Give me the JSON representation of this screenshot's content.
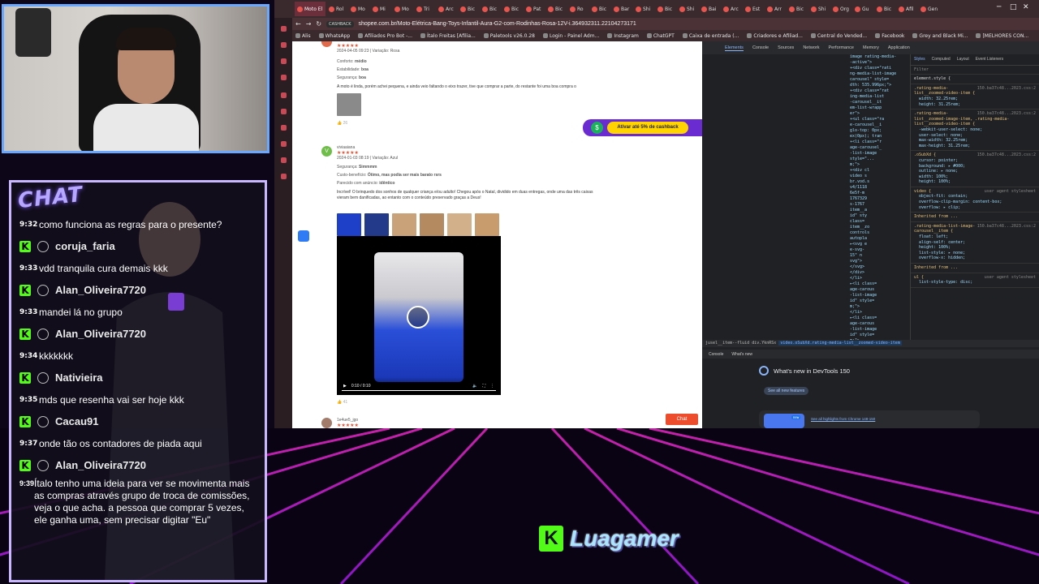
{
  "browser": {
    "active_tab": "Moto El",
    "tabs": [
      "Rol",
      "Mo",
      "Mi",
      "Mo",
      "Tri",
      "Arc",
      "Bic",
      "Bic",
      "Bic",
      "Pat",
      "Bic",
      "Ro",
      "Bic",
      "Bar",
      "Shi",
      "Bic",
      "Shi",
      "Bai",
      "Arc",
      "Est",
      "Arr",
      "Bic",
      "Shi",
      "Org",
      "Gu",
      "Bic",
      "Afil",
      "Gen"
    ],
    "url": "shopee.com.br/Moto-Elétrica-Bang-Toys-Infantil-Aura-G2-com-Rodinhas-Rosa-12V-i.364932311.22104273171",
    "cashback_chip": "CASHBACK",
    "bookmarks": [
      "Alis",
      "WhatsApp",
      "Afiliados Pro Bot -...",
      "Ítalo Freitas [Afilia...",
      "Paletools v26.0.28",
      "Login - Painel Adm...",
      "Instagram",
      "ChatGPT",
      "Caixa de entrada (...",
      "Criadores e Afiliad...",
      "Central do Vended...",
      "Facebook",
      "Grey and Black Mi...",
      "[MELHORES CON..."
    ]
  },
  "review1": {
    "meta": "2024-04-05 09:23 | Variação: Rosa",
    "conforto_label": "Conforto:",
    "conforto": "médio",
    "estabilidade_label": "Estabilidade:",
    "estabilidade": "boa",
    "seguranca_label": "Segurança:",
    "seguranca": "boa",
    "text": "A moto é linda, porém achei pequena, e ainda veio faltando o eixo trazer, tive que comprar a parte, do restante foi uma boa compra o",
    "likes": "26"
  },
  "review2": {
    "avatar": "V",
    "user": "viviaaiana",
    "meta": "2024-01-03 08:19 | Variação: Azul",
    "seguranca_label": "Segurança:",
    "seguranca": "Simmmm",
    "custo_label": "Custo-benefício:",
    "custo": "Ótimo, mas podia ser mais barato rsrs",
    "parecido_label": "Parecido com anúncio:",
    "parecido": "idêntico",
    "text": "Incrível! O brinquedo dos sonhos de qualquer criança e/ou adulto! Chegou após o Natal, dividido em duas entregas, onde uma das três caixas vieram bem danificadas, ao entanto com o conteúdo preservado graças a Deus!",
    "video_time": "0:10 / 0:10",
    "likes": "41"
  },
  "review3": {
    "user": "1e4ue5_jgo"
  },
  "stars": "★★★★★",
  "cashback_banner": {
    "coin": "$",
    "label": "Ativar até 5% de cashback"
  },
  "chat_button": "Chat",
  "devtools": {
    "tabs": [
      "Elements",
      "Console",
      "Sources",
      "Network",
      "Performance",
      "Memory",
      "Application"
    ],
    "active_tab": "Elements",
    "styles_tabs": [
      "Styles",
      "Computed",
      "Layout",
      "Event Listeners"
    ],
    "filter_placeholder": "Filter",
    "element_style": "element.style {",
    "rules": [
      {
        "selector": ".rating-media-list__zoomed-video-item {",
        "source": "150.ba37c48...2023.css:2",
        "props": [
          "width: 32.25rem;",
          "height: 31.25rem;"
        ]
      },
      {
        "selector": ".rating-media-list__zoomed-image-item, .rating-media-list__zoomed-video-item {",
        "source": "150.ba37c48...2023.css:2",
        "props": [
          "-webkit-user-select: none;",
          "user-select: none;",
          "max-width: 32.25rem;",
          "max-height: 31.25rem;"
        ]
      },
      {
        "selector": ".oSubXd {",
        "source": "150.ba37c48...2023.css:2",
        "props": [
          "cursor: pointer;",
          "background: ▸ #000;",
          "outline: ▸ none;",
          "width: 100%;",
          "height: 100%;"
        ]
      },
      {
        "selector": "video {",
        "source": "user agent stylesheet",
        "props": [
          "object-fit: contain;",
          "overflow-clip-margin: content-box;",
          "overflow: ▸ clip;"
        ]
      },
      {
        "selector": "Inherited from ...",
        "source": "",
        "props": []
      },
      {
        "selector": ".rating-media-list-image-carousel__item {",
        "source": "150.ba37c48...2023.css:2",
        "props": [
          "float: left;",
          "align-self: center;",
          "height: 100%;",
          "list-style: ▸ none;",
          "overflow-x: hidden;"
        ]
      },
      {
        "selector": "Inherited from ...",
        "source": "",
        "props": []
      },
      {
        "selector": "ul {",
        "source": "user agent stylesheet",
        "props": [
          "list-style-type: disc;"
        ]
      }
    ],
    "dom_lines": [
      "image rating-media-",
      "-active\">",
      "▾<div class=\"rati",
      "ng-media-list-image",
      "carousel\" style=",
      "dth: 535.996px;\">",
      "▾<div class=\"rat",
      "ing-media-list",
      "-carousel__it",
      "em-list-wrapp",
      "er\">",
      "▾<ul class=\"ra",
      "e-carousel__i",
      "glo-top: 0px;",
      "ex(0px); tran",
      "▾<li class=\"r",
      "age-carousel_",
      "-list-image",
      "style=\"...",
      "m;\">",
      "▾<div cl",
      "video s",
      "br.vod.s",
      "v4/1118",
      "6e5f-m",
      "1767329",
      "s-1767",
      "item__a",
      "id\" sty",
      "class=",
      "item__zo",
      "controls",
      "autopla",
      "▸<svg e",
      "e-svg-",
      "15\" n",
      "svg\">",
      "</svg>",
      "</div>",
      "</li>",
      "▸<li class=",
      "age-carous",
      "-list-image",
      "id\" style=",
      "m;\">",
      "</li>",
      "▸<li class=",
      "age-carous",
      "-list-image",
      "id\" style=",
      "m;\">"
    ],
    "breadcrumbs_prefix": "jusel__item--fluid  div.YknRSx",
    "breadcrumbs_active": "video.oSubXd.rating-media-list__zoomed-video-item",
    "drawer_tabs": [
      "Console",
      "What's new"
    ],
    "whatsnew_title": "What's new in DevTools 150",
    "see_all": "See all new features",
    "highlights": "See all highlights from Chrome 148-150",
    "new_badge": "new"
  },
  "chat": {
    "tag": "CHAT",
    "messages": [
      {
        "time": "9:32",
        "user": "",
        "text": "como funciona as regras para o presente?"
      },
      {
        "time": "9:33",
        "user": "coruja_faria",
        "text": "vdd tranquila cura demais kkk"
      },
      {
        "time": "9:33",
        "user": "Alan_Oliveira7720",
        "text": "mandei lá no grupo"
      },
      {
        "time": "9:34",
        "user": "Alan_Oliveira7720",
        "text": "kkkkkkk"
      },
      {
        "time": "9:35",
        "user": "Nativieira",
        "text": "mds que resenha vai ser hoje kkk"
      },
      {
        "time": "9:37",
        "user": "Cacau91",
        "text": "onde tão os contadores de piada aqui"
      },
      {
        "time": "9:39",
        "user": "Alan_Oliveira7720",
        "text": "Ítalo tenho uma ideia para ver se movimenta mais as compras através grupo de troca de comissões, veja o que acha. a pessoa que comprar 5 vezes, ele ganha uma, sem precisar digitar \"Eu\""
      }
    ]
  },
  "logo": {
    "badge": "K",
    "name": "Luagamer"
  },
  "colors": {
    "kick_green": "#53fc18",
    "shopee_orange": "#ee4d2d",
    "grid_magenta": "#ff2bd6",
    "devtools_bg": "#202124"
  }
}
